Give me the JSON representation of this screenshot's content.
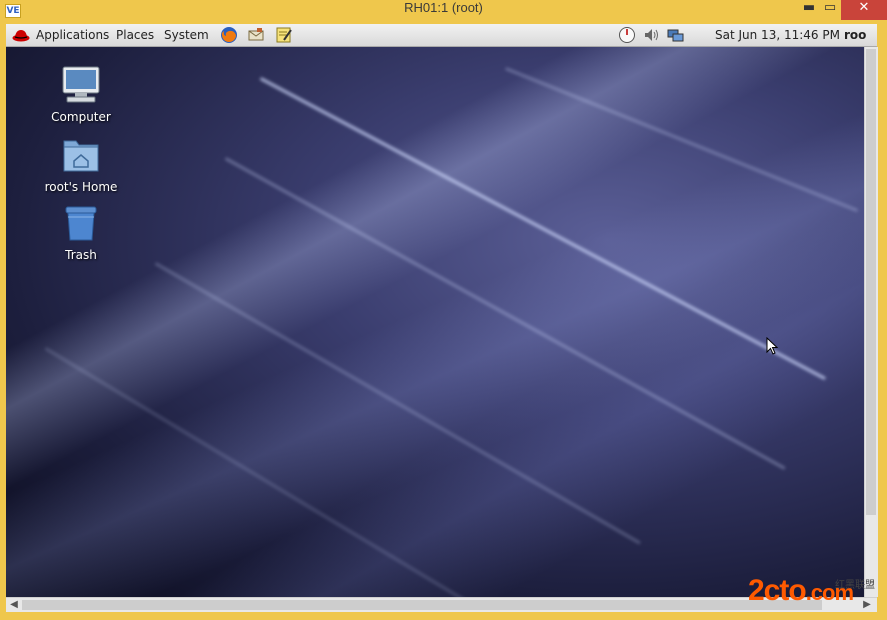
{
  "window": {
    "title": "RH01:1 (root)",
    "app_icon_text": "VE",
    "controls": {
      "minimize": "▬",
      "maximize": "▭",
      "close": "✕"
    }
  },
  "panel": {
    "menus": [
      "Applications",
      "Places",
      "System"
    ],
    "launchers": [
      "firefox-icon",
      "mail-icon",
      "notes-icon"
    ],
    "tray": [
      "gauge-icon",
      "volume-icon",
      "network-icon"
    ],
    "clock": "Sat Jun 13, 11:46 PM",
    "user": "roo"
  },
  "desktop": {
    "icons": [
      {
        "label": "Computer",
        "icon": "computer-icon"
      },
      {
        "label": "root's Home",
        "icon": "home-folder-icon"
      },
      {
        "label": "Trash",
        "icon": "trash-icon"
      }
    ]
  },
  "scrollbars": {
    "left_arrow": "◀",
    "right_arrow": "▶"
  },
  "watermark": {
    "text": "2cto",
    "suffix": ".com",
    "sub": "红黑联盟"
  },
  "colors": {
    "frame": "#efc74c",
    "close_button": "#c9443a",
    "watermark": "#ff5a00"
  }
}
